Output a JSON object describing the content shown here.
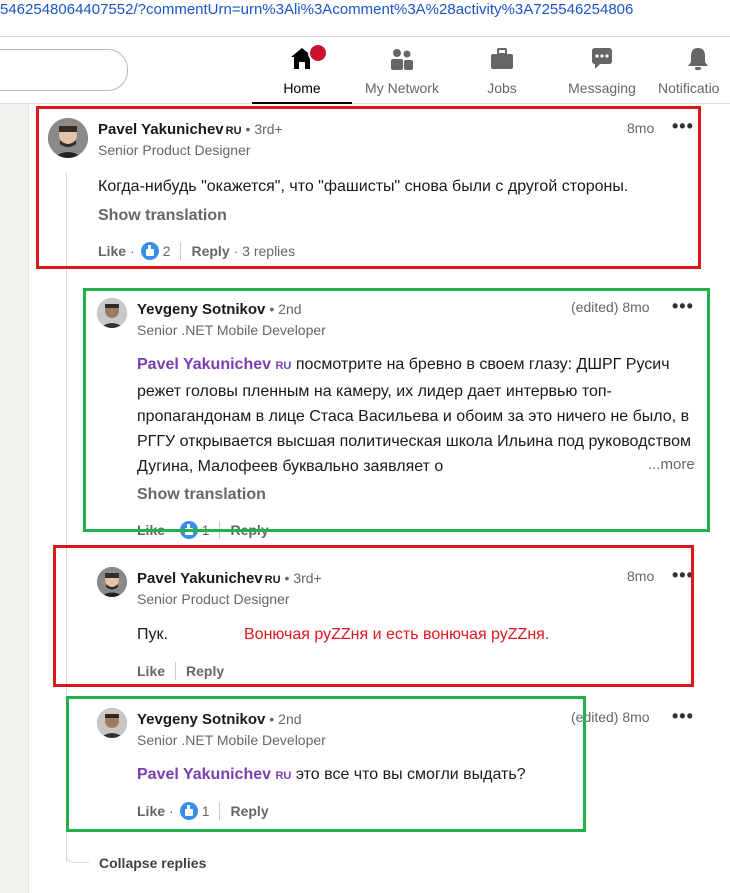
{
  "browser": {
    "url": "5462548064407552/?commentUrn=urn%3Ali%3Acomment%3A%28activity%3A725546254806"
  },
  "nav": {
    "items": [
      {
        "label": "Home",
        "icon": "home-icon"
      },
      {
        "label": "My Network",
        "icon": "network-icon"
      },
      {
        "label": "Jobs",
        "icon": "briefcase-icon"
      },
      {
        "label": "Messaging",
        "icon": "messaging-icon"
      },
      {
        "label": "Notificatio",
        "icon": "bell-icon"
      }
    ]
  },
  "comments": [
    {
      "author": "Pavel Yakunichev",
      "flag": "RU",
      "degree": "• 3rd+",
      "headline": "Senior Product Designer",
      "time": "8mo",
      "text": "Когда-нибудь \"окажется\", что \"фашисты\" снова были с другой стороны.",
      "translate": "Show translation",
      "like": "Like",
      "like_count": "2",
      "reply": "Reply",
      "replies": "· 3 replies"
    },
    {
      "author": "Yevgeny Sotnikov",
      "degree": "• 2nd",
      "headline": "Senior .NET Mobile Developer",
      "time": "(edited) 8mo",
      "mention": "Pavel Yakunichev",
      "mention_flag": "RU",
      "text": "посмотрите на бревно в своем глазу: ДШРГ Русич режет головы пленным на камеру, их лидер дает интервью топ-пропагандонам в лице Стаса Васильева и обоим за это ничего не было, в РГГУ открывается высшая политическая школа Ильина под руководством Дугина, Малофеев буквально заявляет о",
      "more": "...more",
      "translate": "Show translation",
      "like": "Like",
      "like_count": "1",
      "reply": "Reply"
    },
    {
      "author": "Pavel Yakunichev",
      "flag": "RU",
      "degree": "• 3rd+",
      "headline": "Senior Product Designer",
      "time": "8mo",
      "text": "Пук.",
      "like": "Like",
      "reply": "Reply"
    },
    {
      "author": "Yevgeny Sotnikov",
      "degree": "• 2nd",
      "headline": "Senior .NET Mobile Developer",
      "time": "(edited) 8mo",
      "mention": "Pavel Yakunichev",
      "mention_flag": "RU",
      "text": "это все что вы смогли выдать?",
      "like": "Like",
      "like_count": "1",
      "reply": "Reply"
    }
  ],
  "annotation": "Вонючая руZZня и есть вонючая руZZня.",
  "collapse": "Collapse replies",
  "colors": {
    "red_box": "#e0161d",
    "green_box": "#22b14c",
    "mention": "#7a3eb1"
  }
}
